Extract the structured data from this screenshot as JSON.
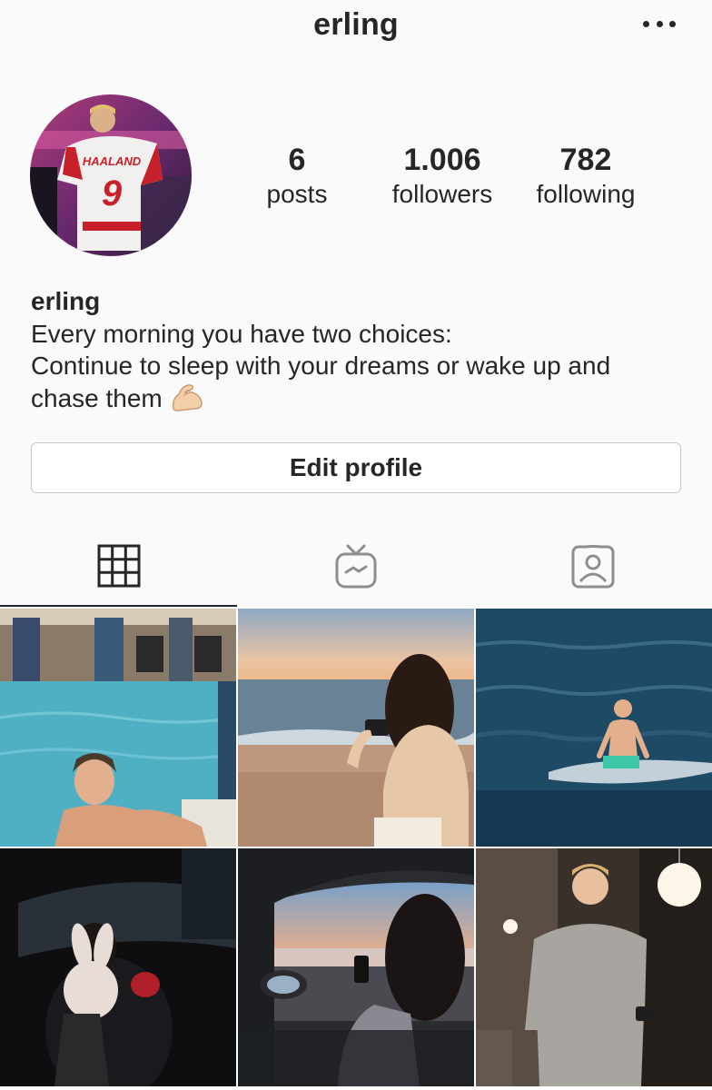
{
  "header": {
    "username": "erling",
    "more_icon": "more-horizontal-icon"
  },
  "profile": {
    "avatar_jersey_name": "HAALAND",
    "avatar_jersey_number": "9",
    "stats": {
      "posts_count": "6",
      "posts_label": "posts",
      "followers_count": "1.006",
      "followers_label": "followers",
      "following_count": "782",
      "following_label": "following"
    },
    "bio": {
      "name": "erling",
      "line1": "Every morning you have two choices:",
      "line2": "Continue to sleep with your dreams or wake up and",
      "line3": "chase them",
      "emoji_icon": "flexed-biceps-icon"
    },
    "edit_button_label": "Edit profile"
  },
  "tabs": [
    {
      "icon": "grid-icon",
      "active": true
    },
    {
      "icon": "igtv-icon",
      "active": false
    },
    {
      "icon": "tagged-icon",
      "active": false
    }
  ],
  "posts": [
    {
      "scene": "pool"
    },
    {
      "scene": "beach-photo"
    },
    {
      "scene": "sea-swim"
    },
    {
      "scene": "car-bunny"
    },
    {
      "scene": "car-sunset"
    },
    {
      "scene": "kitchen"
    }
  ],
  "colors": {
    "text": "#262626",
    "background": "#fafafa",
    "border": "#c7c7c7",
    "icon_inactive": "#8e8e8e"
  }
}
